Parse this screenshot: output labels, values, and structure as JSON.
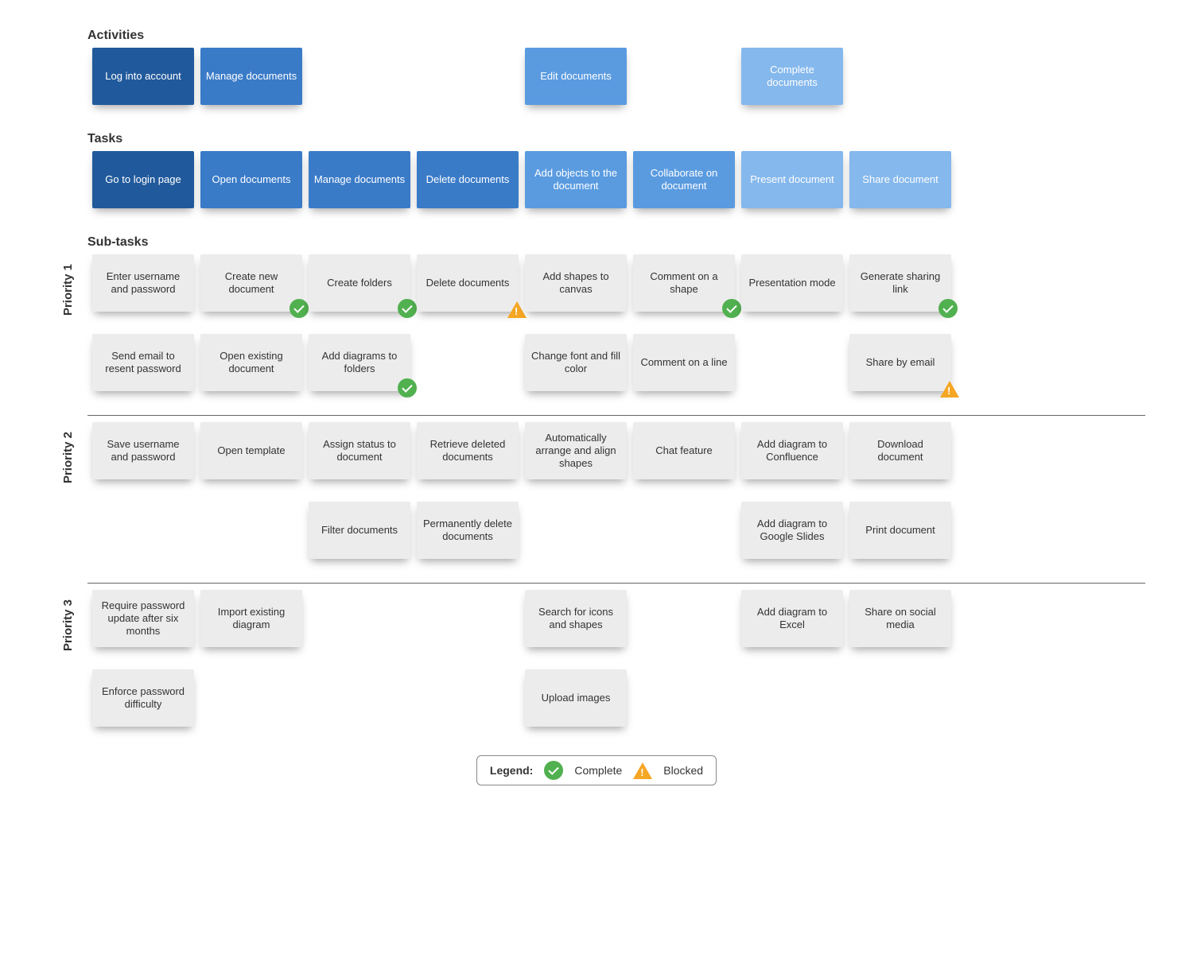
{
  "sections": {
    "activities": "Activities",
    "tasks": "Tasks",
    "subtasks": "Sub-tasks"
  },
  "priorities": [
    "Priority 1",
    "Priority 2",
    "Priority 3"
  ],
  "activities_row": [
    {
      "label": "Log into account",
      "color": "dark"
    },
    {
      "label": "Manage documents",
      "color": "med"
    },
    null,
    null,
    {
      "label": "Edit documents",
      "color": "light"
    },
    null,
    {
      "label": "Complete documents",
      "color": "pale"
    },
    null
  ],
  "tasks_row": [
    {
      "label": "Go to login page",
      "color": "dark"
    },
    {
      "label": "Open documents",
      "color": "med"
    },
    {
      "label": "Manage documents",
      "color": "med"
    },
    {
      "label": "Delete documents",
      "color": "med"
    },
    {
      "label": "Add objects to the document",
      "color": "light"
    },
    {
      "label": "Collaborate on document",
      "color": "light"
    },
    {
      "label": "Present document",
      "color": "pale"
    },
    {
      "label": "Share document",
      "color": "pale"
    }
  ],
  "p1": [
    [
      {
        "label": "Enter username and password"
      },
      {
        "label": "Create new document",
        "status": "complete"
      },
      {
        "label": "Create folders",
        "status": "complete"
      },
      {
        "label": "Delete documents",
        "status": "blocked"
      },
      {
        "label": "Add shapes to canvas"
      },
      {
        "label": "Comment on a shape",
        "status": "complete"
      },
      {
        "label": "Presentation mode"
      },
      {
        "label": "Generate sharing link",
        "status": "complete"
      }
    ],
    [
      {
        "label": "Send email to resent password"
      },
      {
        "label": "Open existing document"
      },
      {
        "label": "Add diagrams to folders",
        "status": "complete"
      },
      null,
      {
        "label": "Change font and fill color"
      },
      {
        "label": "Comment on a line"
      },
      null,
      {
        "label": "Share by email",
        "status": "blocked"
      }
    ]
  ],
  "p2": [
    [
      {
        "label": "Save username and password"
      },
      {
        "label": "Open template"
      },
      {
        "label": "Assign status to document"
      },
      {
        "label": "Retrieve deleted documents"
      },
      {
        "label": "Automatically arrange and align shapes"
      },
      {
        "label": "Chat feature"
      },
      {
        "label": "Add diagram to Confluence"
      },
      {
        "label": "Download document"
      }
    ],
    [
      null,
      null,
      {
        "label": "Filter documents"
      },
      {
        "label": "Permanently delete documents"
      },
      null,
      null,
      {
        "label": "Add diagram to Google Slides"
      },
      {
        "label": "Print document"
      }
    ]
  ],
  "p3": [
    [
      {
        "label": "Require password update after six months"
      },
      {
        "label": "Import existing diagram"
      },
      null,
      null,
      {
        "label": "Search for icons and shapes"
      },
      null,
      {
        "label": "Add diagram to Excel"
      },
      {
        "label": "Share on social media"
      }
    ],
    [
      {
        "label": "Enforce password difficulty"
      },
      null,
      null,
      null,
      {
        "label": "Upload images"
      },
      null,
      null,
      null
    ]
  ],
  "legend": {
    "title": "Legend:",
    "complete": "Complete",
    "blocked": "Blocked"
  }
}
